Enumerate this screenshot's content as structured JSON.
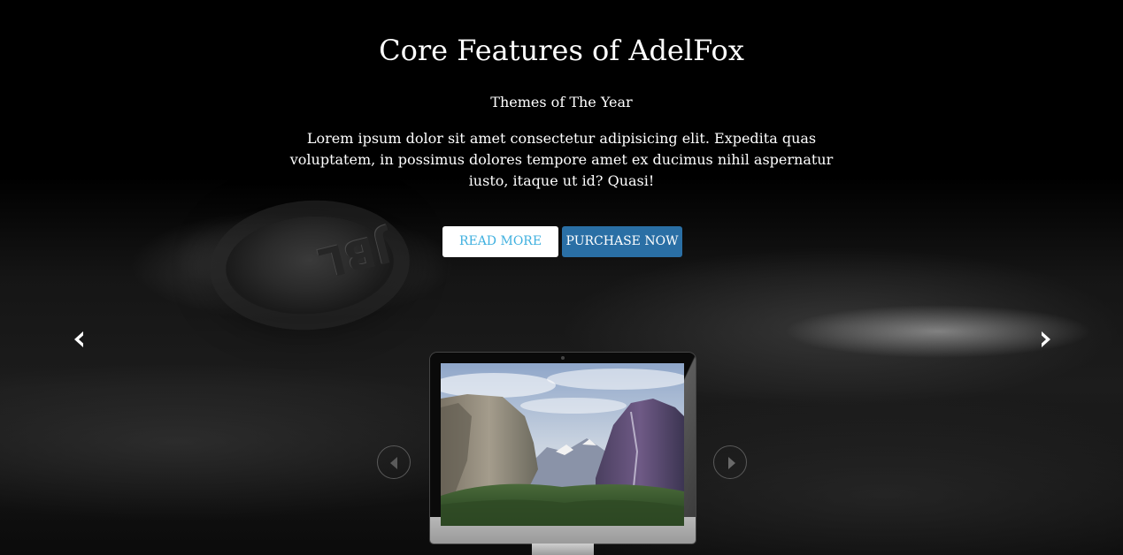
{
  "hero": {
    "title": "Core Features of AdelFox",
    "subtitle": "Themes of The Year",
    "description": "Lorem ipsum dolor sit amet consectetur adipisicing elit. Expedita quas voluptatem, in possimus dolores tempore amet ex ducimus nihil aspernatur iusto, itaque ut id? Quasi!"
  },
  "buttons": {
    "read_more": "READ MORE",
    "purchase_now": "PURCHASE NOW"
  },
  "background": {
    "logo_text": "JBL"
  },
  "icons": {
    "carousel_prev": "chevron-left-icon",
    "carousel_next": "chevron-right-icon",
    "slider_prev": "triangle-left-icon",
    "slider_next": "triangle-right-icon"
  },
  "colors": {
    "read_more_text": "#3fb0df",
    "purchase_bg": "#2a6fa5",
    "background": "#000000"
  }
}
